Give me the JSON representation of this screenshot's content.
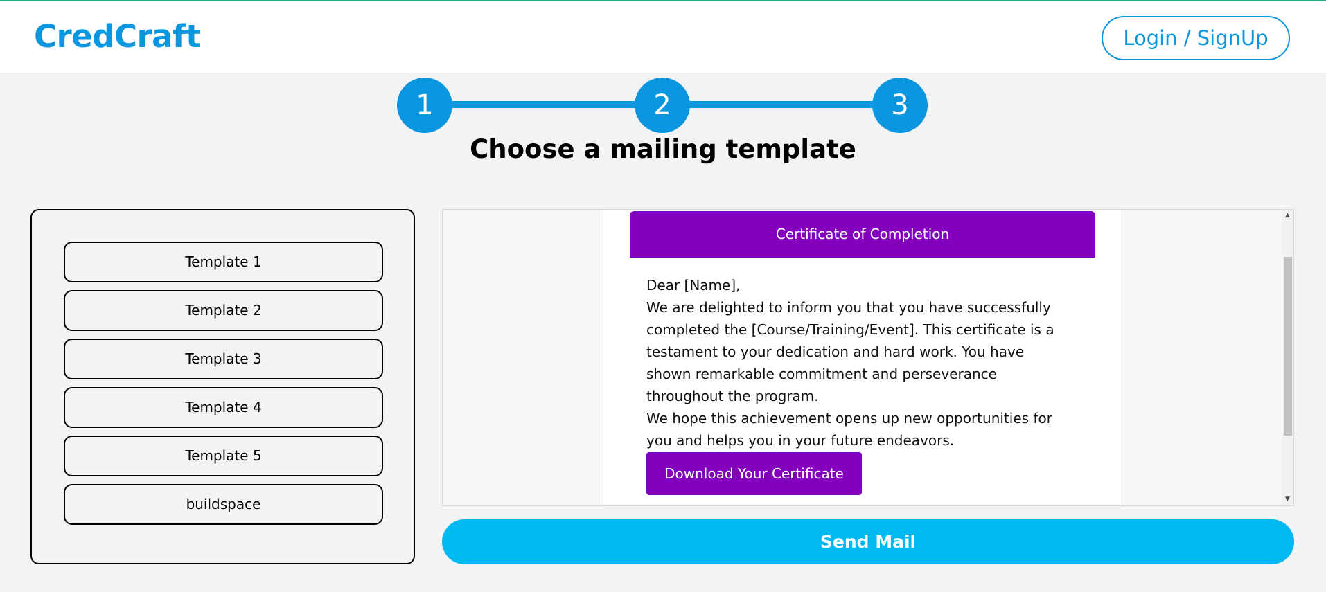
{
  "app": {
    "logo": "CredCraft",
    "login_label": "Login / SignUp"
  },
  "stepper": {
    "steps": [
      "1",
      "2",
      "3"
    ],
    "current_step": 3
  },
  "page": {
    "title": "Choose a mailing template"
  },
  "templates": [
    {
      "label": "Template 1"
    },
    {
      "label": "Template 2"
    },
    {
      "label": "Template 3"
    },
    {
      "label": "Template 4"
    },
    {
      "label": "Template 5"
    },
    {
      "label": "buildspace"
    }
  ],
  "preview": {
    "header": "Certificate of Completion",
    "greeting": "Dear [Name],",
    "paragraph1": "We are delighted to inform you that you have successfully completed the [Course/Training/Event]. This certificate is a testament to your dedication and hard work. You have shown remarkable commitment and perseverance throughout the program.",
    "paragraph2": "We hope this achievement opens up new opportunities for you and helps you in your future endeavors.",
    "download_label": "Download Your Certificate",
    "scroll_up_icon": "triangle-up",
    "scroll_down_icon": "triangle-down"
  },
  "actions": {
    "send_label": "Send Mail"
  },
  "colors": {
    "brand": "#0b97e0",
    "send_button": "#00b9f0",
    "certificate_accent": "#8300bd",
    "page_background": "#f2f3f5"
  }
}
